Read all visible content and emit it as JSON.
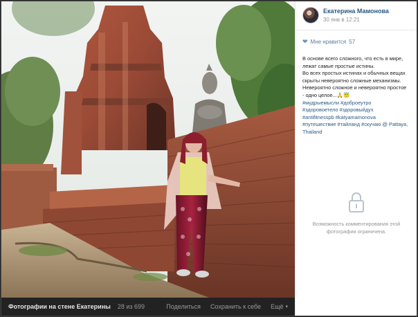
{
  "author": {
    "name": "Екатерина Мамонова",
    "date": "30 янв в 12:21"
  },
  "likes": {
    "label": "Мне нравится",
    "count": "57",
    "icon": "heart-icon"
  },
  "caption": {
    "lines": [
      "В основе всего сложного, что есть в мире,",
      "лежат самые простые истины.",
      "Во всех простых истинах и обычных вещах",
      "скрыты невероятно сложные механизмы.",
      "Невероятно сложное и невероятно простое",
      "- одно целое...🙏😇"
    ],
    "tag_lines": [
      "#мудрыемысли #доброеутро",
      "#здоровоетело #здоровыйдух",
      "#antifitnesspb #katyamamonova",
      "#путешествие #тайланд #скучаю @ Pattaya,",
      "Thailand"
    ]
  },
  "comments": {
    "locked_text_1": "Возможность комментирования этой",
    "locked_text_2": "фотографии ограничена.",
    "icon": "lock-icon"
  },
  "photo_bar": {
    "album": "Фотографии на стене Екатерины",
    "counter": "28 из 699",
    "share": "Поделиться",
    "save": "Сохранить к себе",
    "more": "Ещё"
  },
  "colors": {
    "link": "#2a5885",
    "muted": "#939393",
    "bar_bg": "#222222"
  }
}
